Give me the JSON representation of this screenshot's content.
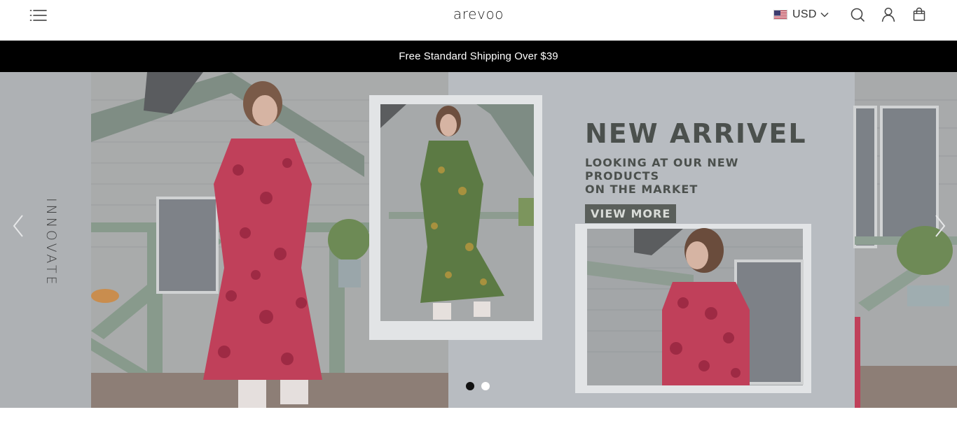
{
  "header": {
    "logo": "arevoo",
    "currency": "USD",
    "icons": [
      "menu-icon",
      "us-flag-icon",
      "chevron-down-icon",
      "search-icon",
      "user-icon",
      "cart-icon"
    ]
  },
  "announcement": {
    "text": "Free Standard Shipping Over $39"
  },
  "hero": {
    "headline": "NEW ARRIVEL",
    "subline_1": "LOOKING AT OUR NEW PRODUCTS",
    "subline_2": "ON THE MARKET",
    "cta": "VIEW MORE",
    "vertical_text": "INNOVATE",
    "slide_count": 2,
    "active_slide": 1
  },
  "colors": {
    "announcement_bg": "#000000",
    "hero_bg": "#b9bcc1",
    "dress_red": "#c0405a",
    "dress_green": "#5c7a44"
  }
}
